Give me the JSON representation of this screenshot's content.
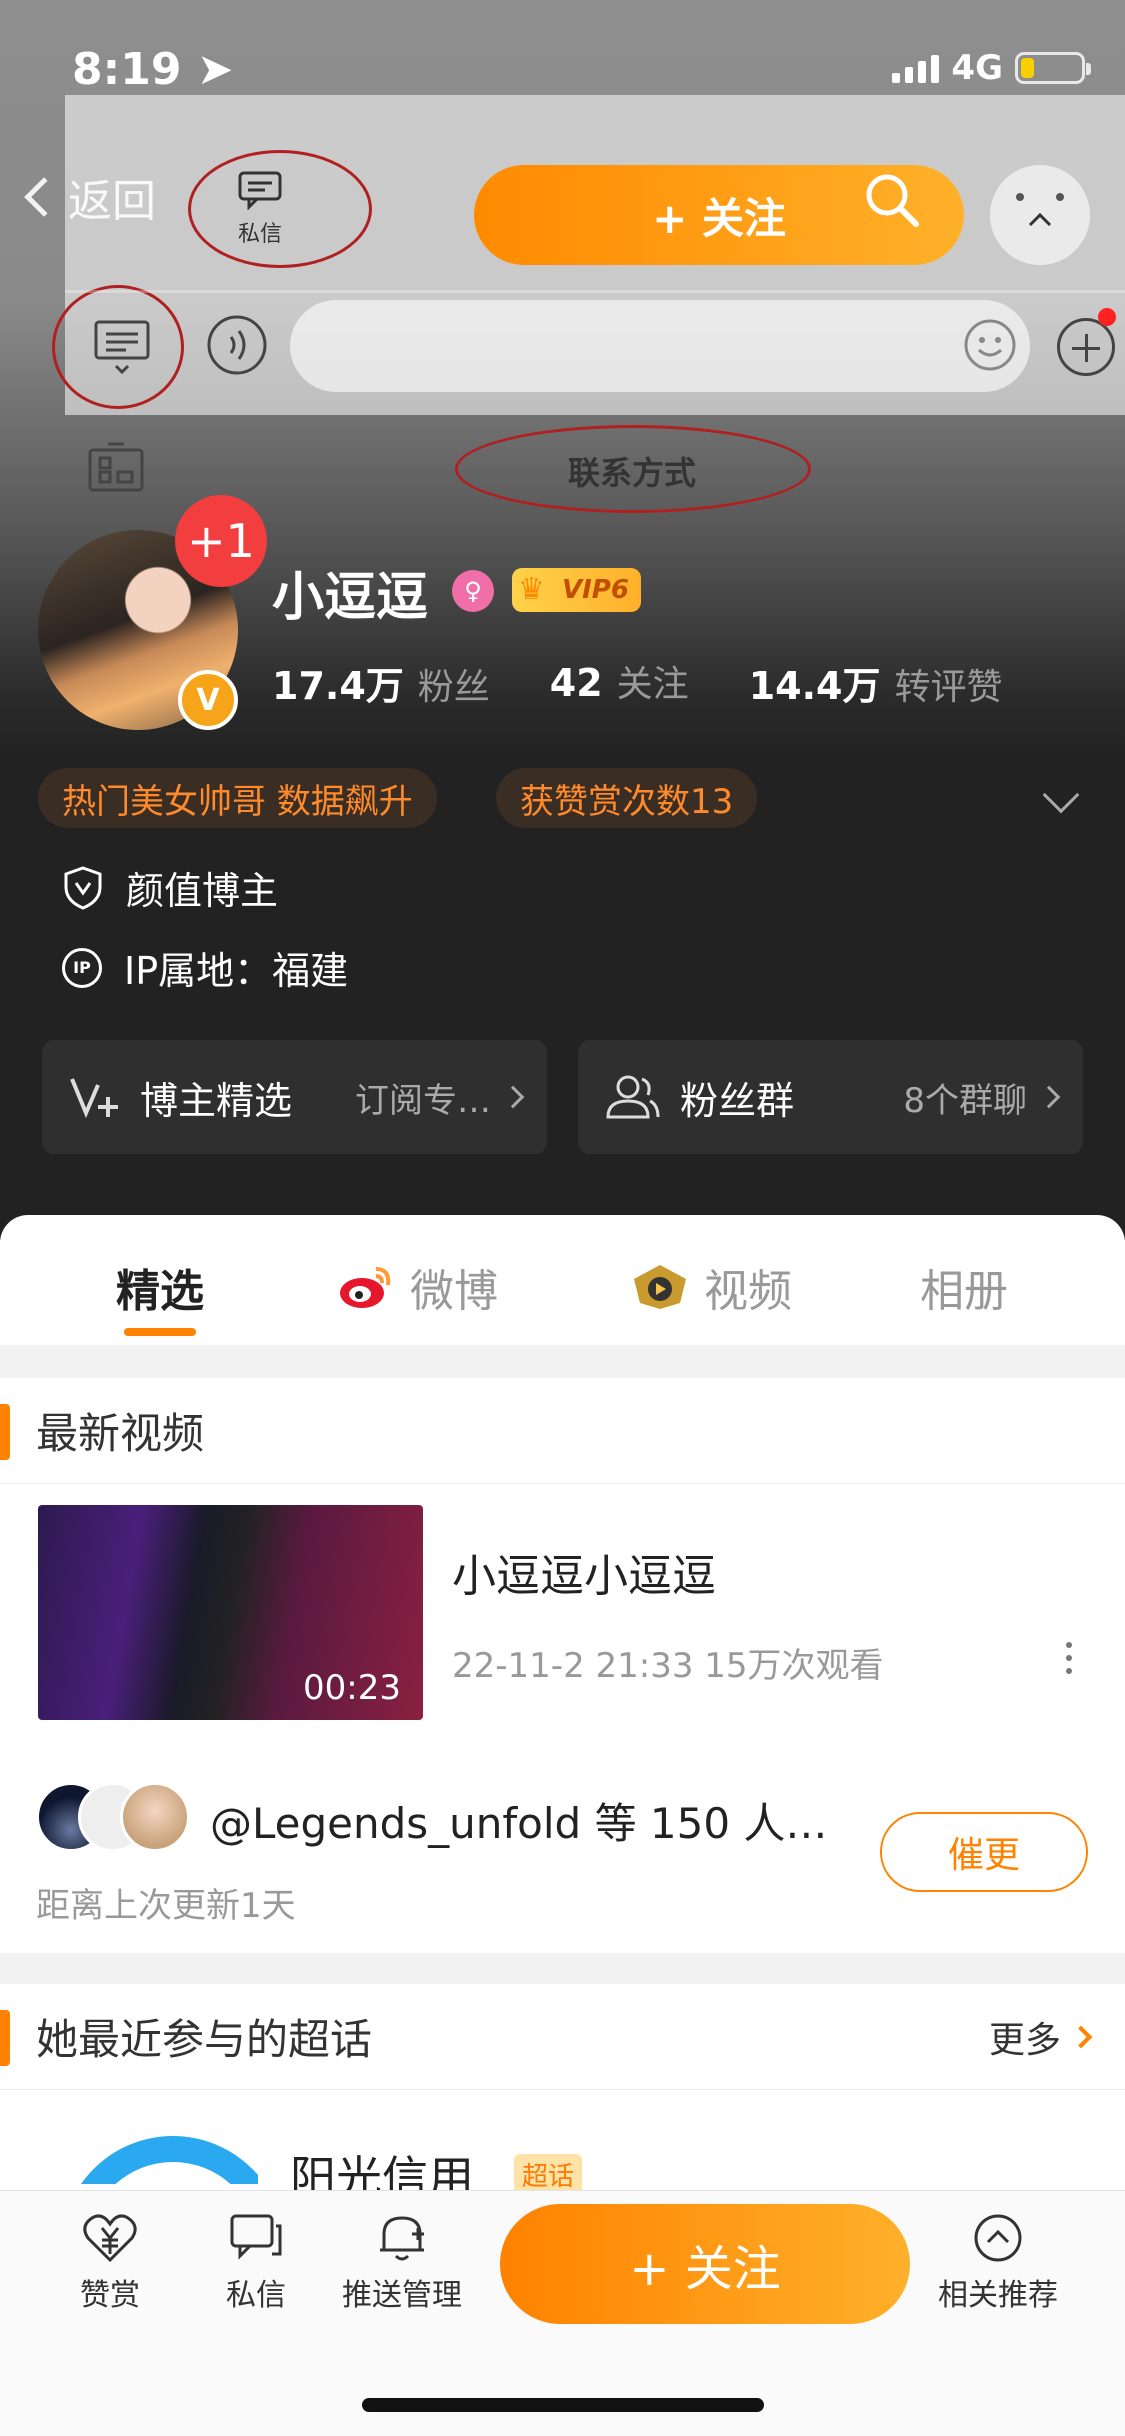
{
  "status_bar": {
    "time": "8:19",
    "network": "4G"
  },
  "overlay": {
    "back_label": "返回",
    "private_message_label": "私信",
    "follow_label": "+ 关注",
    "contact_label": "联系方式"
  },
  "profile": {
    "name": "小逗逗",
    "vip_label": "VIP6",
    "verified_badge": "V",
    "notification_badge": "+1",
    "stats": [
      {
        "value": "17.4万",
        "label": "粉丝"
      },
      {
        "value": "42",
        "label": "关注"
      },
      {
        "value": "14.4万",
        "label": "转评赞"
      }
    ],
    "tags": [
      "热门美女帅哥 数据飙升",
      "获赞赏次数13"
    ],
    "category": "颜值博主",
    "ip_location": "IP属地：福建"
  },
  "cards": [
    {
      "title": "博主精选",
      "sub": "订阅专…"
    },
    {
      "title": "粉丝群",
      "sub": "8个群聊"
    }
  ],
  "tabs": [
    "精选",
    "微博",
    "视频",
    "相册"
  ],
  "latest_video": {
    "section_title": "最新视频",
    "title": "小逗逗小逗逗",
    "meta": "22-11-2 21:33 15万次观看",
    "duration": "00:23",
    "liked_by": "@Legends_unfold 等 150 人…",
    "since_update": "距离上次更新1天",
    "urge_label": "催更"
  },
  "topics": {
    "section_title": "她最近参与的超话",
    "more_label": "更多",
    "first_name": "阳光信用",
    "badge": "超话"
  },
  "bottom_bar": {
    "items": [
      "赞赏",
      "私信",
      "推送管理",
      "相关推荐"
    ],
    "follow_label": "+ 关注"
  },
  "colors": {
    "accent": "#ff8200",
    "badge_red": "#f23e3e",
    "vip_gold": "#ffb02a"
  }
}
